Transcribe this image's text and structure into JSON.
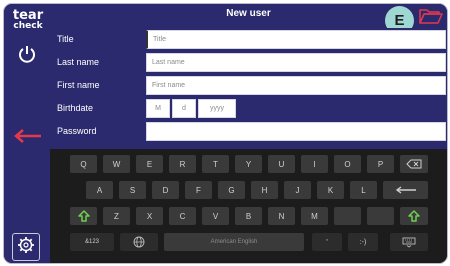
{
  "app": {
    "logo_line1": "tear",
    "logo_line2": "check"
  },
  "header": {
    "title": "New user",
    "badge": "E"
  },
  "form": {
    "rows": [
      {
        "label": "Title",
        "placeholder": "Title"
      },
      {
        "label": "Last name",
        "placeholder": "Last name"
      },
      {
        "label": "First name",
        "placeholder": "First name"
      },
      {
        "label": "Birthdate"
      },
      {
        "label": "Password"
      }
    ],
    "birthdate": {
      "month": "M",
      "day": "d",
      "year": "yyyy"
    }
  },
  "keyboard": {
    "row1": [
      "Q",
      "W",
      "E",
      "R",
      "T",
      "Y",
      "U",
      "I",
      "O",
      "P"
    ],
    "row2": [
      "A",
      "S",
      "D",
      "F",
      "G",
      "H",
      "J",
      "K",
      "L"
    ],
    "row3": [
      "Z",
      "X",
      "C",
      "V",
      "B",
      "N",
      "M"
    ],
    "numbers_label": "&123",
    "space_label": "American English",
    "apostrophe": "'",
    "smiley": ":-)"
  },
  "colors": {
    "primary": "#2c2a6e",
    "accent_red": "#e2394b",
    "badge": "#9fd8d2",
    "shift_green": "#6fd04f"
  }
}
